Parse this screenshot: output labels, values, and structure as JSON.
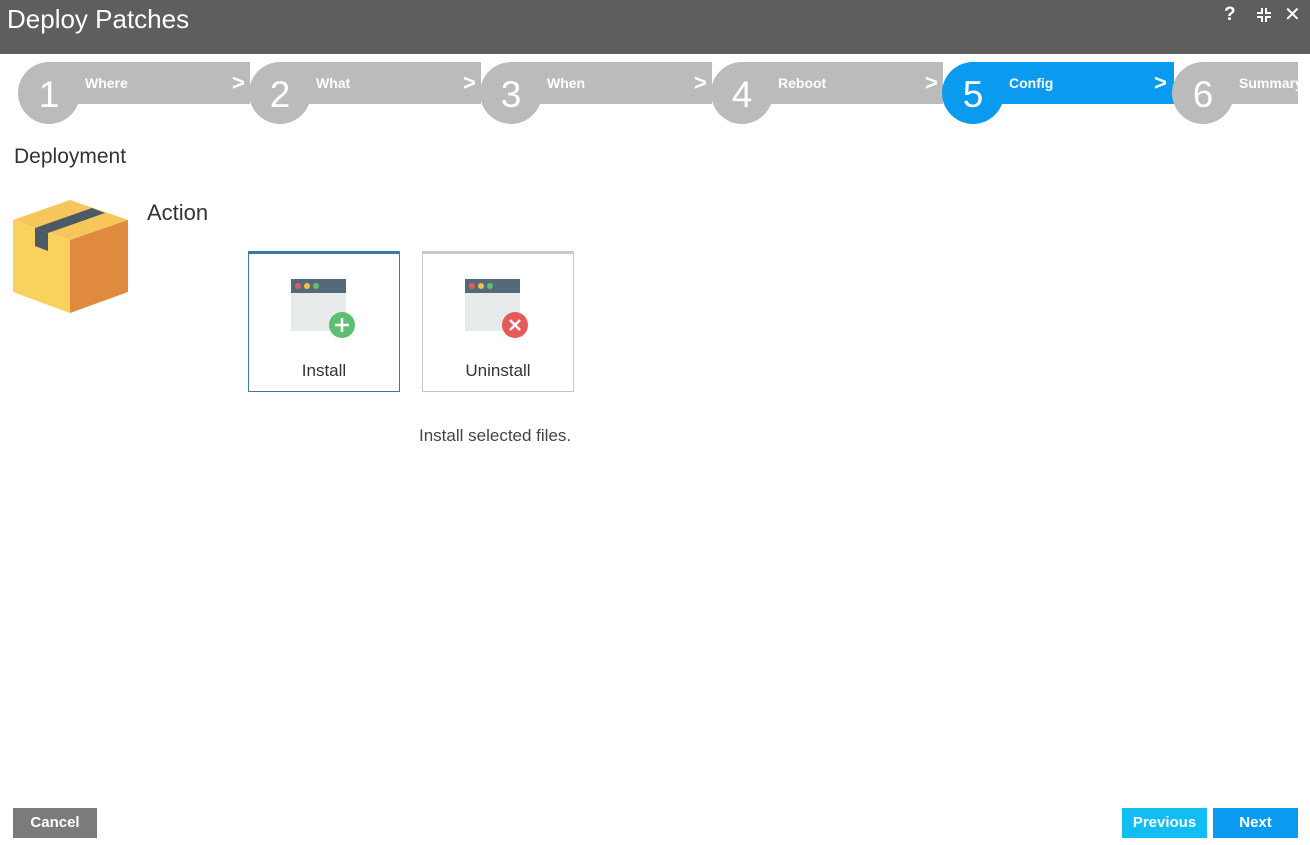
{
  "window": {
    "title": "Deploy Patches"
  },
  "wizard": {
    "steps": [
      {
        "number": "1",
        "label": "Where"
      },
      {
        "number": "2",
        "label": "What"
      },
      {
        "number": "3",
        "label": "When"
      },
      {
        "number": "4",
        "label": "Reboot"
      },
      {
        "number": "5",
        "label": "Config"
      },
      {
        "number": "6",
        "label": "Summary"
      }
    ],
    "active_step": "5",
    "active_color": "#0a9bf0",
    "inactive_color": "#bbbbbb"
  },
  "deployment": {
    "section_title": "Deployment",
    "action_label": "Action",
    "options": [
      {
        "label": "Install",
        "icon": "window-add-icon",
        "selected": true
      },
      {
        "label": "Uninstall",
        "icon": "window-remove-icon",
        "selected": false
      }
    ],
    "description": "Install selected files."
  },
  "footer": {
    "cancel_label": "Cancel",
    "previous_label": "Previous",
    "next_label": "Next"
  }
}
